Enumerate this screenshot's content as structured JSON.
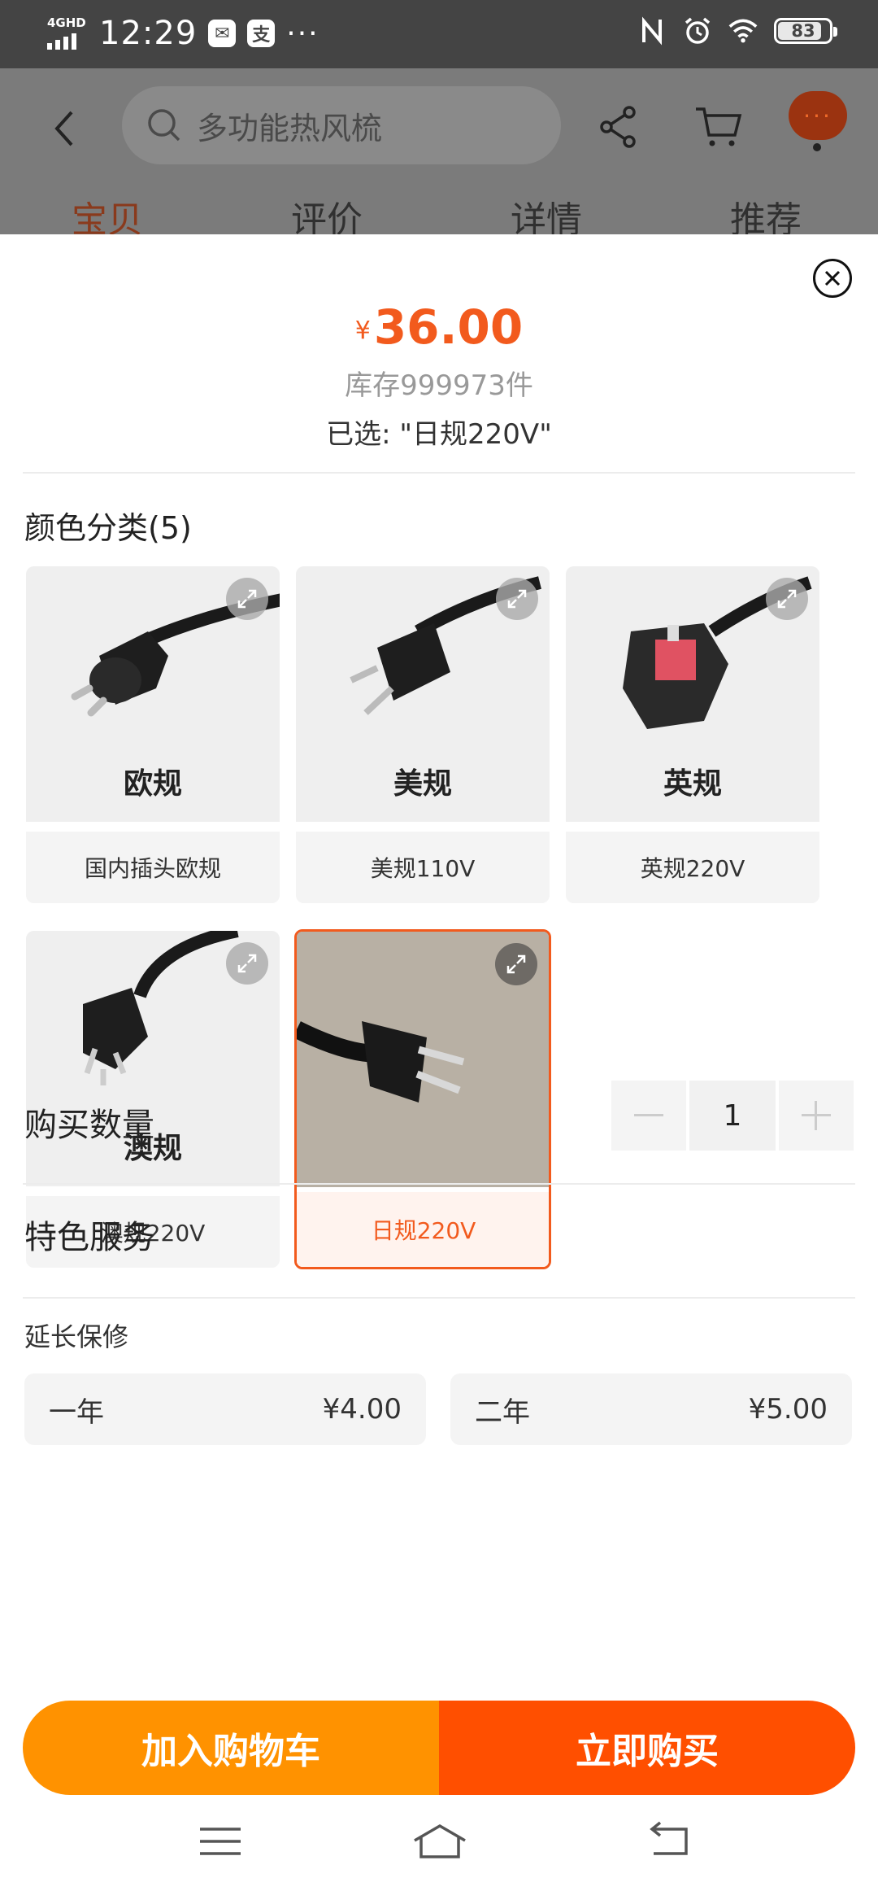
{
  "status_bar": {
    "network": "4GHD",
    "time": "12:29",
    "battery": "83",
    "more": "···"
  },
  "header": {
    "search_placeholder": "多功能热风梳",
    "more": "···",
    "tabs": [
      {
        "label": "宝贝",
        "active": true
      },
      {
        "label": "评价",
        "active": false
      },
      {
        "label": "详情",
        "active": false
      },
      {
        "label": "推荐",
        "active": false
      }
    ]
  },
  "sheet": {
    "currency": "¥",
    "price": "36.00",
    "stock": "库存999973件",
    "selected": "已选: \"日规220V\"",
    "color_section_title": "颜色分类(5)",
    "options": [
      {
        "big_label": "欧规",
        "label": "国内插头欧规",
        "selected": false
      },
      {
        "big_label": "美规",
        "label": "美规110V",
        "selected": false
      },
      {
        "big_label": "英规",
        "label": "英规220V",
        "selected": false
      },
      {
        "big_label": "澳规",
        "label": "澳规220V",
        "selected": false
      },
      {
        "big_label": "",
        "label": "日规220V",
        "selected": true
      }
    ],
    "quantity_label": "购买数量",
    "quantity": "1",
    "services_title": "特色服务",
    "warranty_title": "延长保修",
    "warranty_options": [
      {
        "label": "一年",
        "price": "¥4.00"
      },
      {
        "label": "二年",
        "price": "¥5.00"
      }
    ],
    "add_to_cart": "加入购物车",
    "buy_now": "立即购买"
  },
  "colors": {
    "accent": "#f25a1d",
    "cart_button": "#ff9200",
    "buy_button": "#ff4f00"
  }
}
